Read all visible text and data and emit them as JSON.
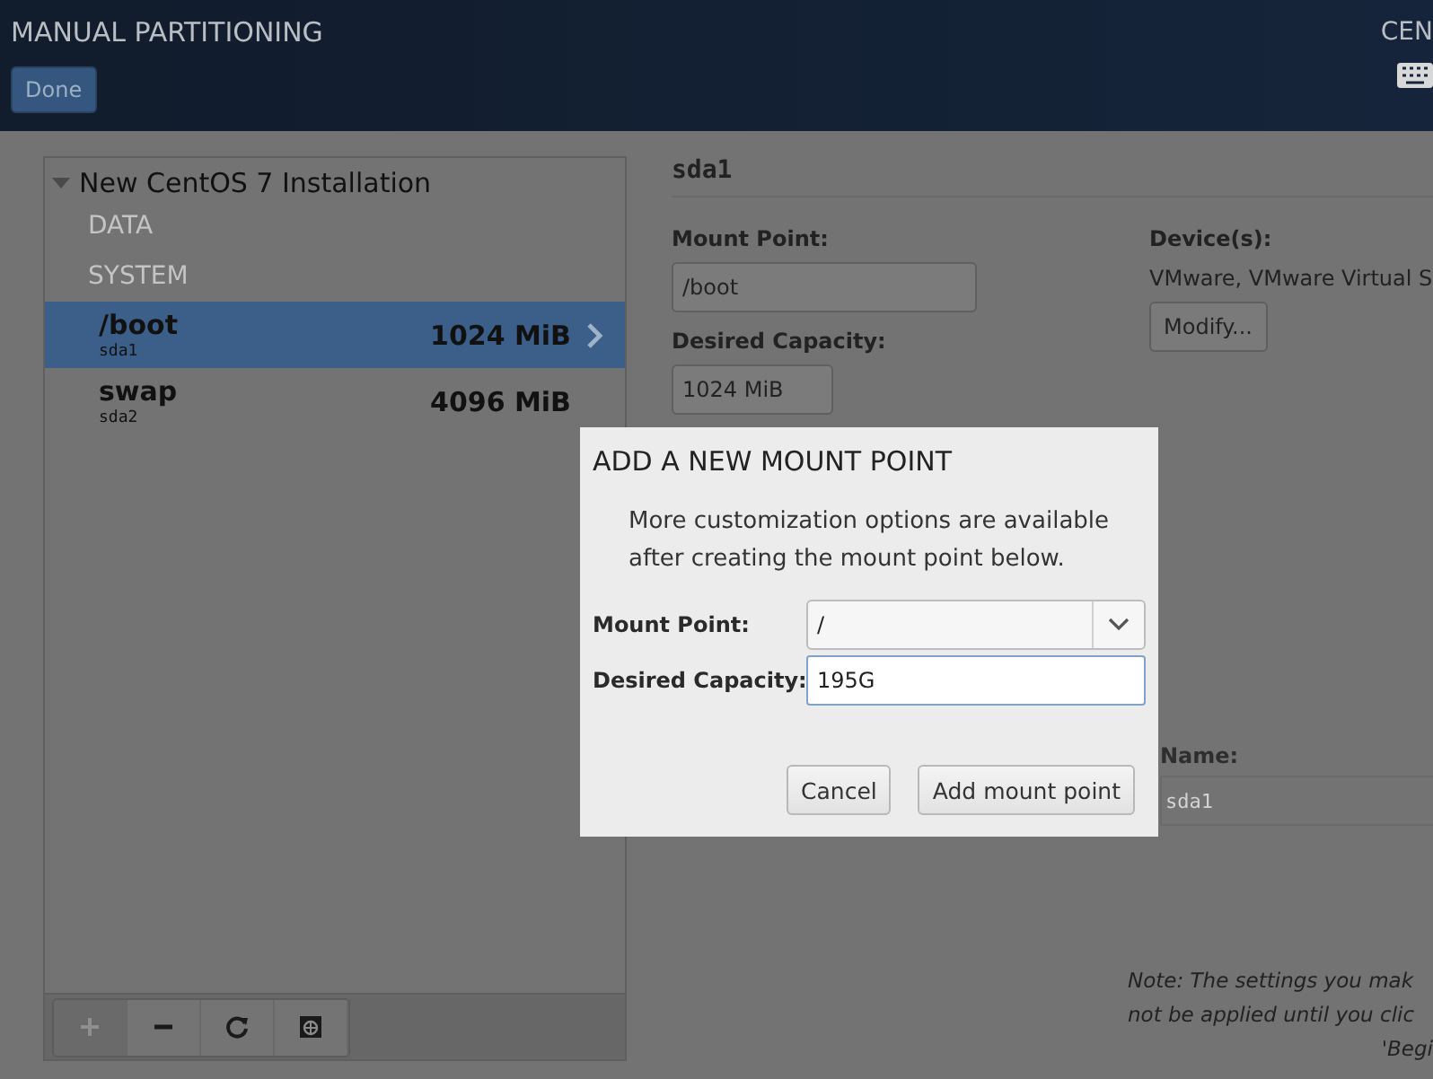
{
  "header": {
    "title": "MANUAL PARTITIONING",
    "done_button": "Done",
    "product_label": "CEN"
  },
  "partition_list": {
    "title": "New CentOS 7 Installation",
    "expanded": true,
    "sections": [
      {
        "label": "DATA"
      },
      {
        "label": "SYSTEM",
        "items": [
          {
            "mount": "/boot",
            "device": "sda1",
            "size": "1024 MiB",
            "selected": true
          },
          {
            "mount": "swap",
            "device": "sda2",
            "size": "4096 MiB",
            "selected": false
          }
        ]
      }
    ]
  },
  "details": {
    "title": "sda1",
    "mount_point_label": "Mount Point:",
    "mount_point_value": "/boot",
    "capacity_label": "Desired Capacity:",
    "capacity_value": "1024 MiB",
    "devices_label": "Device(s):",
    "devices_value": "VMware, VMware Virtual S",
    "modify_button": "Modify...",
    "name_label": "Name:",
    "name_value": "sda1",
    "note_lines": [
      "Note:  The settings you mak",
      "not be applied until you clic",
      "'Begi"
    ]
  },
  "dialog": {
    "title": "ADD A NEW MOUNT POINT",
    "message": "More customization options are available after creating the mount point below.",
    "mount_point_label": "Mount Point:",
    "mount_point_value": "/",
    "capacity_label": "Desired Capacity:",
    "capacity_value": "195G",
    "buttons": [
      "Cancel",
      "Add mount point"
    ]
  }
}
